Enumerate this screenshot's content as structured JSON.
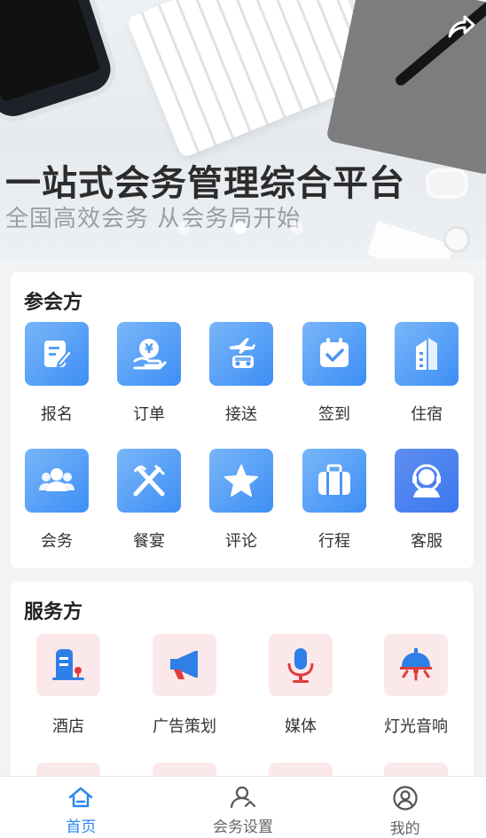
{
  "banner": {
    "title": "一站式会务管理综合平台",
    "subtitle": "全国高效会务 从会务局开始",
    "share_icon": "share-arrow-icon",
    "slides": 3,
    "active_slide": 2
  },
  "attendee": {
    "title": "参会方",
    "items": [
      {
        "label": "报名",
        "icon": "edit-form-icon"
      },
      {
        "label": "订单",
        "icon": "yen-hand-icon"
      },
      {
        "label": "接送",
        "icon": "plane-car-icon"
      },
      {
        "label": "签到",
        "icon": "calendar-check-icon"
      },
      {
        "label": "住宿",
        "icon": "building-icon"
      },
      {
        "label": "会务",
        "icon": "group-icon"
      },
      {
        "label": "餐宴",
        "icon": "fork-knife-icon"
      },
      {
        "label": "评论",
        "icon": "star-icon"
      },
      {
        "label": "行程",
        "icon": "suitcase-icon"
      },
      {
        "label": "客服",
        "icon": "headset-icon"
      }
    ]
  },
  "provider": {
    "title": "服务方",
    "items": [
      {
        "label": "酒店",
        "icon": "hotel-icon"
      },
      {
        "label": "广告策划",
        "icon": "megaphone-icon"
      },
      {
        "label": "媒体",
        "icon": "microphone-icon"
      },
      {
        "label": "灯光音响",
        "icon": "stage-light-icon"
      }
    ]
  },
  "tabbar": {
    "items": [
      {
        "label": "首页",
        "icon": "home-icon",
        "active": true
      },
      {
        "label": "会务设置",
        "icon": "user-settings-icon",
        "active": false
      },
      {
        "label": "我的",
        "icon": "profile-icon",
        "active": false
      }
    ]
  },
  "colors": {
    "accent": "#2f86ee",
    "icon_gradient_start": "#79b6f8",
    "icon_gradient_end": "#3d8ef6",
    "pink_bg": "#fbe8ea",
    "red_icon": "#e23b3b",
    "blue_icon": "#2f7fe8"
  }
}
